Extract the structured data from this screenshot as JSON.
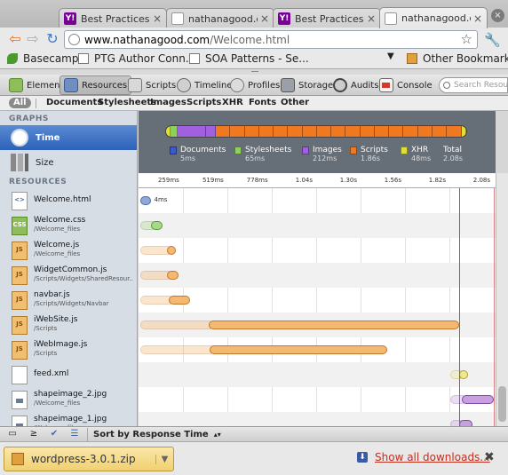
{
  "tabs": [
    {
      "title": "Best Practices f...",
      "favicon": "yahoo",
      "active": false
    },
    {
      "title": "nathanagood.c...",
      "favicon": "page",
      "active": false
    },
    {
      "title": "Best Practices f...",
      "favicon": "yahoo",
      "active": false
    },
    {
      "title": "nathanagood.c...",
      "favicon": "page",
      "active": true
    }
  ],
  "address": {
    "host": "www.nathanagood.com",
    "path": "/Welcome.html"
  },
  "bookmarks": {
    "items": [
      {
        "label": "Basecamp",
        "icon": "leaf"
      },
      {
        "label": "PTG Author Conn...",
        "icon": "doc"
      },
      {
        "label": "SOA Patterns - Se...",
        "icon": "doc"
      }
    ],
    "other": "Other Bookmarks"
  },
  "devtools": {
    "tabs": [
      "Elements",
      "Resources",
      "Scripts",
      "Timeline",
      "Profiles",
      "Storage",
      "Audits",
      "Console"
    ],
    "active_tab": "Resources",
    "search_placeholder": "Search Resources"
  },
  "filters": [
    "All",
    "Documents",
    "Stylesheets",
    "Images",
    "Scripts",
    "XHR",
    "Fonts",
    "Other"
  ],
  "sidebar": {
    "graphs_header": "GRAPHS",
    "graphs": [
      "Time",
      "Size"
    ],
    "resources_header": "RESOURCES",
    "resources": [
      {
        "name": "Welcome.html",
        "path": "",
        "type": "html"
      },
      {
        "name": "Welcome.css",
        "path": "/Welcome_files",
        "type": "css"
      },
      {
        "name": "Welcome.js",
        "path": "/Welcome_files",
        "type": "js"
      },
      {
        "name": "WidgetCommon.js",
        "path": "/Scripts/Widgets/SharedResour...",
        "type": "js"
      },
      {
        "name": "navbar.js",
        "path": "/Scripts/Widgets/Navbar",
        "type": "js"
      },
      {
        "name": "iWebSite.js",
        "path": "/Scripts",
        "type": "js"
      },
      {
        "name": "iWebImage.js",
        "path": "/Scripts",
        "type": "js"
      },
      {
        "name": "feed.xml",
        "path": "",
        "type": "xml"
      },
      {
        "name": "shapeimage_2.jpg",
        "path": "/Welcome_files",
        "type": "img"
      },
      {
        "name": "shapeimage_1.jpg",
        "path": "/Welcome_files",
        "type": "img"
      }
    ]
  },
  "summary": {
    "segments": [
      {
        "type": "xhr",
        "weight": 1.5
      },
      {
        "type": "css",
        "weight": 2
      },
      {
        "type": "img",
        "weight": 9
      },
      {
        "type": "img",
        "weight": 3
      },
      {
        "type": "js",
        "weight": 4.5
      },
      {
        "type": "js",
        "weight": 4.5
      },
      {
        "type": "js",
        "weight": 4.5
      },
      {
        "type": "js",
        "weight": 4.5
      },
      {
        "type": "js",
        "weight": 4.5
      },
      {
        "type": "js",
        "weight": 4.5
      },
      {
        "type": "js",
        "weight": 4.5
      },
      {
        "type": "js",
        "weight": 4.5
      },
      {
        "type": "js",
        "weight": 4.5
      },
      {
        "type": "js",
        "weight": 4.5
      },
      {
        "type": "js",
        "weight": 4.5
      },
      {
        "type": "js",
        "weight": 4.5
      },
      {
        "type": "js",
        "weight": 4.5
      },
      {
        "type": "js",
        "weight": 4.5
      },
      {
        "type": "js",
        "weight": 4.5
      },
      {
        "type": "js",
        "weight": 4.5
      },
      {
        "type": "js",
        "weight": 4.5
      },
      {
        "type": "xhr",
        "weight": 1.5
      }
    ],
    "legend": [
      {
        "label": "Documents",
        "value": "5ms",
        "color": "#3a5ad0"
      },
      {
        "label": "Stylesheets",
        "value": "65ms",
        "color": "#8fd05a"
      },
      {
        "label": "Images",
        "value": "212ms",
        "color": "#a060e0"
      },
      {
        "label": "Scripts",
        "value": "1.86s",
        "color": "#f07820"
      },
      {
        "label": "XHR",
        "value": "48ms",
        "color": "#e0e030"
      },
      {
        "label": "Total",
        "value": "2.08s",
        "color": ""
      }
    ]
  },
  "colors": {
    "html": "#3a5ad0",
    "css": "#8fd05a",
    "img": "#a060e0",
    "js": "#f07820",
    "xhr": "#e0e030"
  },
  "ruler": {
    "max_ms": 2080,
    "ticks": [
      {
        "label": "259ms",
        "ms": 259
      },
      {
        "label": "519ms",
        "ms": 519
      },
      {
        "label": "778ms",
        "ms": 778
      },
      {
        "label": "1.04s",
        "ms": 1040
      },
      {
        "label": "1.30s",
        "ms": 1300
      },
      {
        "label": "1.56s",
        "ms": 1560
      },
      {
        "label": "1.82s",
        "ms": 1820
      },
      {
        "label": "2.08s",
        "ms": 2080
      }
    ]
  },
  "timings": [
    {
      "type": "html",
      "start": 0,
      "mid": 0,
      "end": 60,
      "label": "4ms"
    },
    {
      "type": "css",
      "start": 0,
      "mid": 60,
      "end": 130,
      "label": ""
    },
    {
      "type": "js",
      "start": 0,
      "mid": 155,
      "end": 205,
      "label": ""
    },
    {
      "type": "js",
      "start": 0,
      "mid": 155,
      "end": 225,
      "label": ""
    },
    {
      "type": "js",
      "start": 0,
      "mid": 165,
      "end": 290,
      "label": ""
    },
    {
      "type": "js",
      "start": 0,
      "mid": 400,
      "end": 1865,
      "label": ""
    },
    {
      "type": "js",
      "start": 0,
      "mid": 405,
      "end": 1445,
      "label": ""
    },
    {
      "type": "xhr",
      "start": 1815,
      "mid": 1865,
      "end": 1920,
      "label": ""
    },
    {
      "type": "img",
      "start": 1815,
      "mid": 1880,
      "end": 2070,
      "label": ""
    },
    {
      "type": "img",
      "start": 1815,
      "mid": 1865,
      "end": 1945,
      "label": ""
    }
  ],
  "statusbar": {
    "sort_label": "Sort by Response Time"
  },
  "download": {
    "file": "wordpress-3.0.1.zip",
    "show_all": "Show all downloads..."
  }
}
